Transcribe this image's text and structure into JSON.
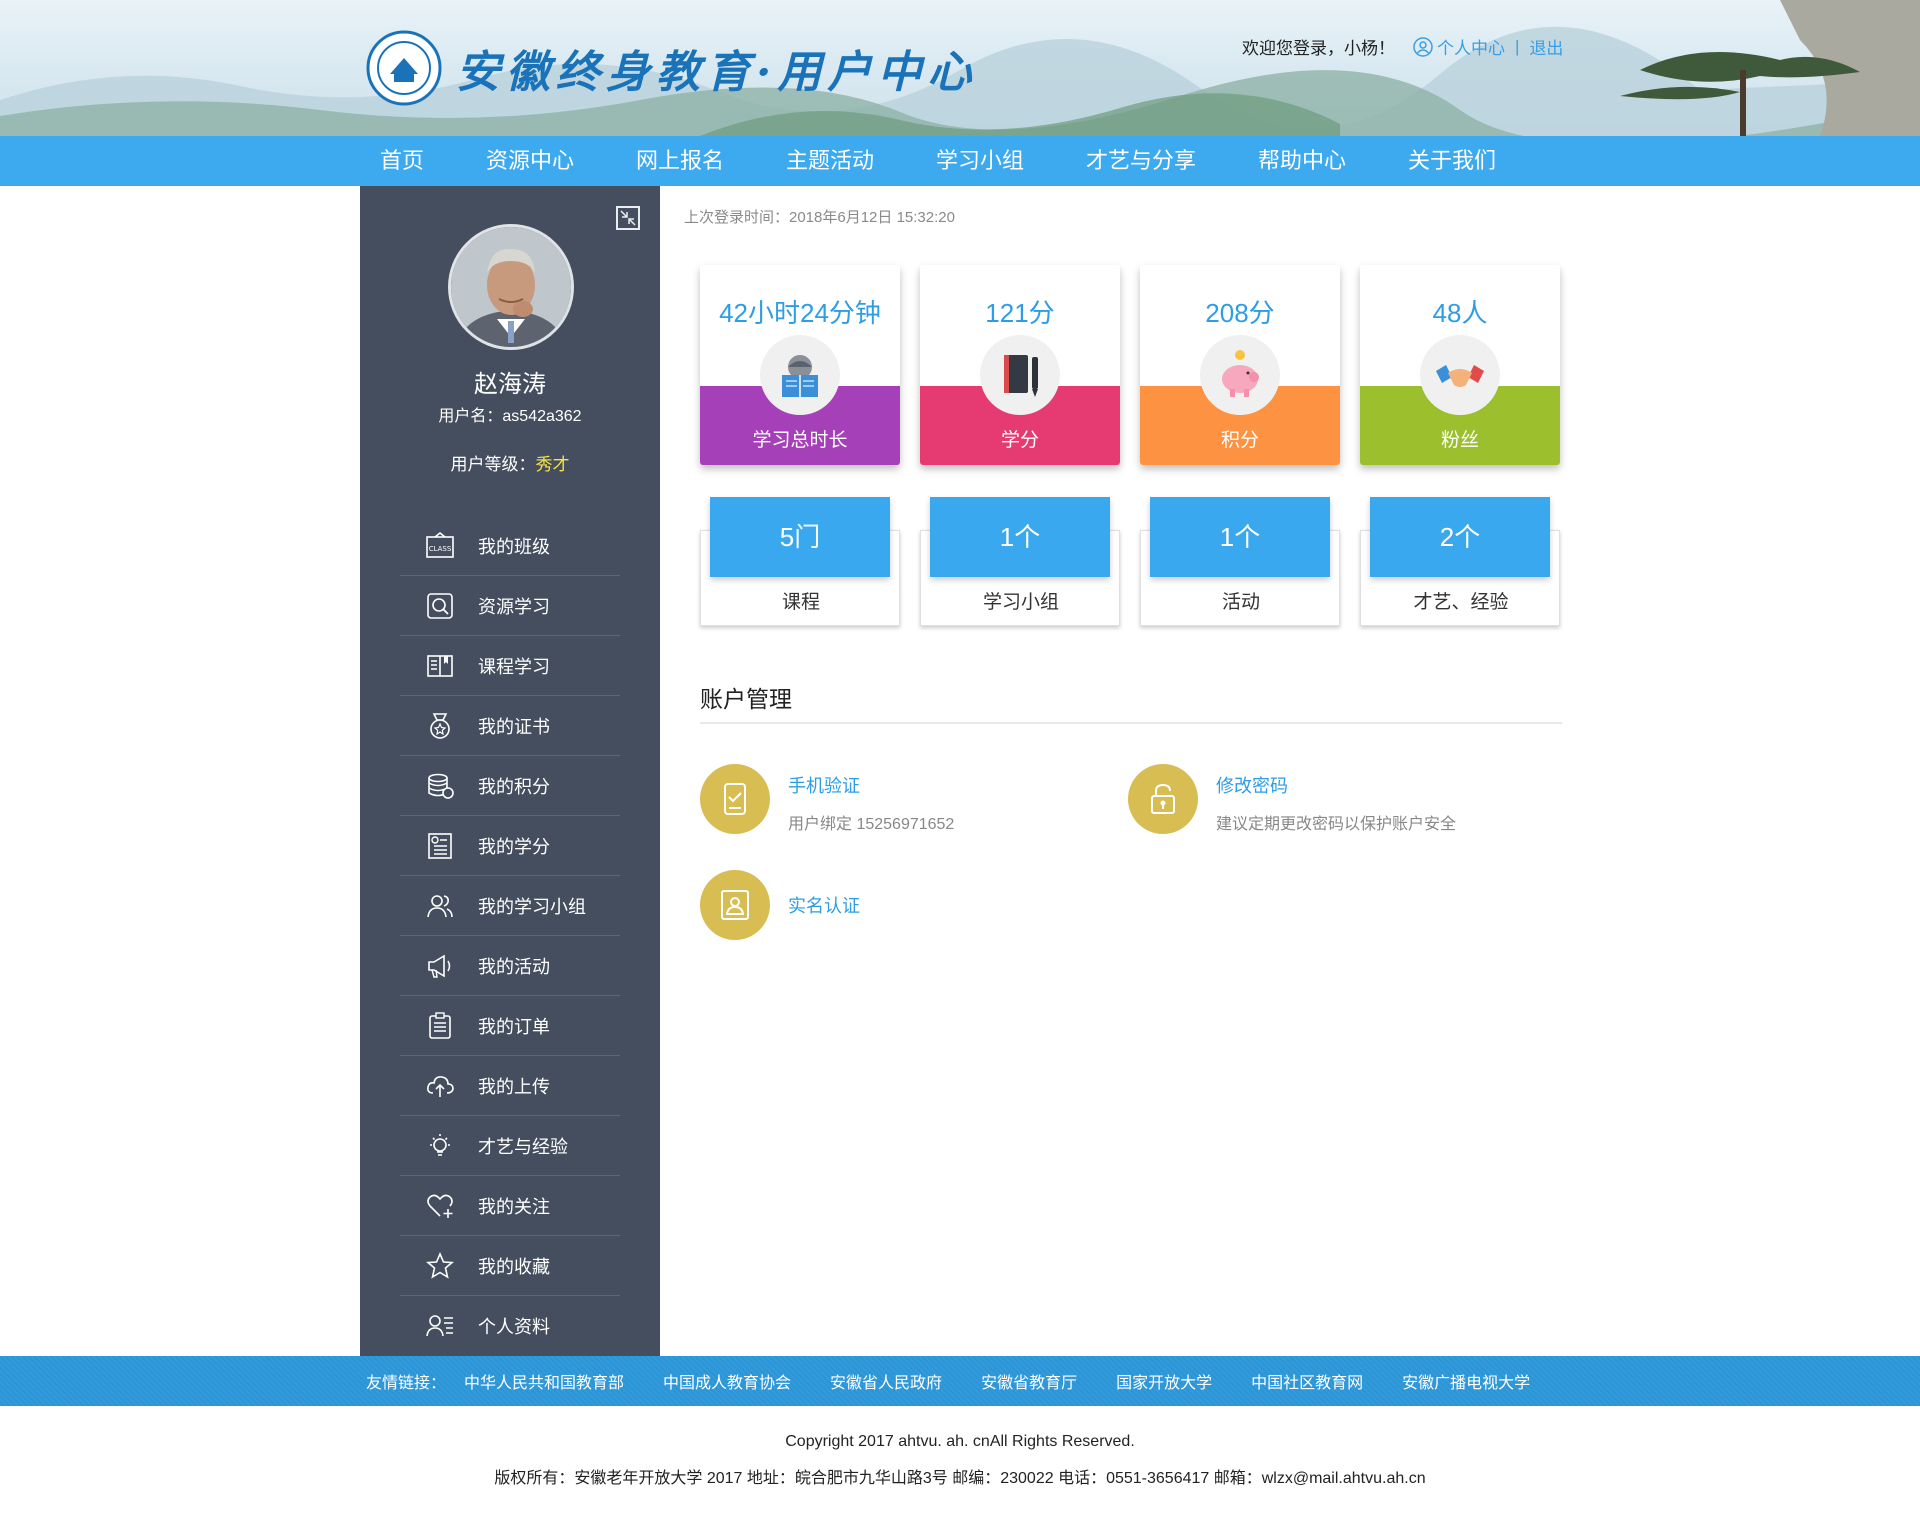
{
  "header": {
    "site_title": "安徽终身教育·用户中心",
    "welcome": "欢迎您登录，小杨！",
    "user_center": "个人中心",
    "separator": "|",
    "logout": "退出"
  },
  "nav": [
    "首页",
    "资源中心",
    "网上报名",
    "主题活动",
    "学习小组",
    "才艺与分享",
    "帮助中心",
    "关于我们"
  ],
  "profile": {
    "real_name": "赵海涛",
    "username_line": "用户名：as542a362",
    "level_label": "用户等级：",
    "level_value": "秀才"
  },
  "menu": [
    {
      "label": "我的班级",
      "icon": "class-icon"
    },
    {
      "label": "资源学习",
      "icon": "search-resource-icon"
    },
    {
      "label": "课程学习",
      "icon": "book-icon"
    },
    {
      "label": "我的证书",
      "icon": "medal-icon"
    },
    {
      "label": "我的积分",
      "icon": "coins-icon"
    },
    {
      "label": "我的学分",
      "icon": "credit-doc-icon"
    },
    {
      "label": "我的学习小组",
      "icon": "group-icon"
    },
    {
      "label": "我的活动",
      "icon": "megaphone-icon"
    },
    {
      "label": "我的订单",
      "icon": "order-icon"
    },
    {
      "label": "我的上传",
      "icon": "upload-icon"
    },
    {
      "label": "才艺与经验",
      "icon": "bulb-icon"
    },
    {
      "label": "我的关注",
      "icon": "heart-plus-icon"
    },
    {
      "label": "我的收藏",
      "icon": "star-icon"
    },
    {
      "label": "个人资料",
      "icon": "profile-icon"
    }
  ],
  "last_login": "上次登录时间：2018年6月12日   15:32:20",
  "stats": [
    {
      "value": "42小时24分钟",
      "label": "学习总时长",
      "color": "#a640b8"
    },
    {
      "value": "121分",
      "label": "学分",
      "color": "#e63a73"
    },
    {
      "value": "208分",
      "label": "积分",
      "color": "#fd9243"
    },
    {
      "value": "48人",
      "label": "粉丝",
      "color": "#9cbf2e"
    }
  ],
  "counts": [
    {
      "value": "5门",
      "label": "课程"
    },
    {
      "value": "1个",
      "label": "学习小组"
    },
    {
      "value": "1个",
      "label": "活动"
    },
    {
      "value": "2个",
      "label": "才艺、经验"
    }
  ],
  "account": {
    "title": "账户管理",
    "phone": {
      "link": "手机验证",
      "desc": "用户绑定  15256971652"
    },
    "password": {
      "link": "修改密码",
      "desc": "建议定期更改密码以保护账户安全"
    },
    "realname": {
      "link": "实名认证"
    }
  },
  "footer": {
    "links_label": "友情链接：",
    "links": [
      "中华人民共和国教育部",
      "中国成人教育协会",
      "安徽省人民政府",
      "安徽省教育厅",
      "国家开放大学",
      "中国社区教育网",
      "安徽广播电视大学"
    ],
    "copyright": "Copyright 2017 ahtvu. ah. cnAll Rights Reserved.",
    "address": "版权所有：安徽老年开放大学 2017 地址：皖合肥市九华山路3号 邮编：230022 电话：0551-3656417 邮箱：wlzx@mail.ahtvu.ah.cn"
  },
  "colors": {
    "accent": "#3daaf0",
    "sidebar": "#444e5e",
    "gold": "#d8bd53"
  }
}
